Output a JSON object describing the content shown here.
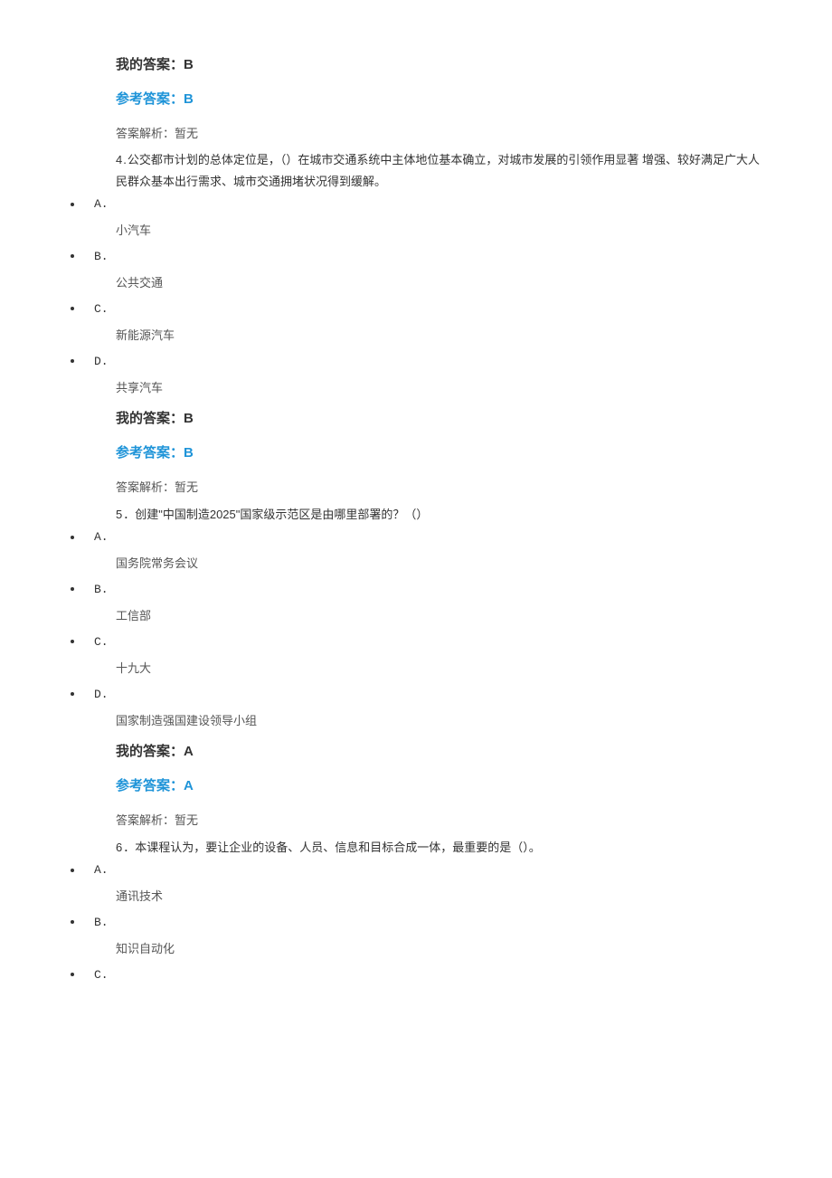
{
  "q3": {
    "my_answer_label": "我的答案：",
    "my_answer_value": "B",
    "ref_answer_label": "参考答案：",
    "ref_answer_value": "B",
    "analysis": "答案解析：暂无"
  },
  "q4": {
    "number": "4.",
    "text": "公交都市计划的总体定位是，（）在城市交通系统中主体地位基本确立，对城市发展的引领作用显著 增强、较好满足广大人民群众基本出行需求、城市交通拥堵状况得到缓解。",
    "options": [
      {
        "letter": "A.",
        "text": "小汽车"
      },
      {
        "letter": "B.",
        "text": "公共交通"
      },
      {
        "letter": "C.",
        "text": "新能源汽车"
      },
      {
        "letter": "D.",
        "text": "共享汽车"
      }
    ],
    "my_answer_label": "我的答案：",
    "my_answer_value": "B",
    "ref_answer_label": "参考答案：",
    "ref_answer_value": "B",
    "analysis": "答案解析：暂无"
  },
  "q5": {
    "number": "5",
    "text": "．创建\"中国制造2025\"国家级示范区是由哪里部署的？（）",
    "options": [
      {
        "letter": "A.",
        "text": "国务院常务会议"
      },
      {
        "letter": "B.",
        "text": "工信部"
      },
      {
        "letter": "C.",
        "text": "十九大"
      },
      {
        "letter": "D.",
        "text": "国家制造强国建设领导小组"
      }
    ],
    "my_answer_label": "我的答案：",
    "my_answer_value": "A",
    "ref_answer_label": "参考答案：",
    "ref_answer_value": "A",
    "analysis": "答案解析：暂无"
  },
  "q6": {
    "number": "6",
    "text": "．本课程认为，要让企业的设备、人员、信息和目标合成一体，最重要的是（）。",
    "options": [
      {
        "letter": "A.",
        "text": "通讯技术"
      },
      {
        "letter": "B.",
        "text": "知识自动化"
      },
      {
        "letter": "C.",
        "text": ""
      }
    ]
  }
}
